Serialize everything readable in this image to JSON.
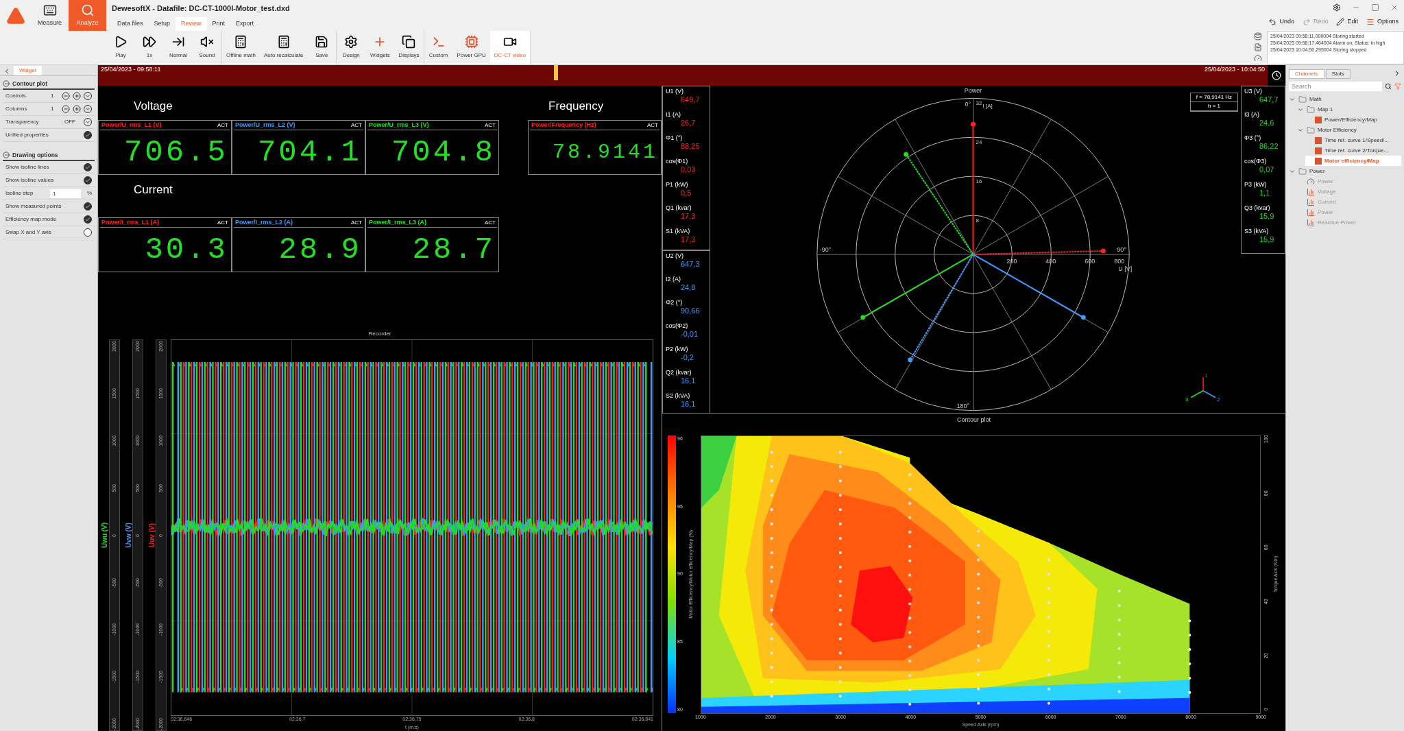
{
  "ribbon": {
    "title": "DewesoftX - Datafile: DC-CT-1000I-Motor_test.dxd",
    "modes": [
      {
        "kind": "measure",
        "label": "Measure",
        "selected": false
      },
      {
        "kind": "analyze",
        "label": "Analyze",
        "selected": true
      }
    ],
    "menu": [
      {
        "label": "Data files",
        "selected": false
      },
      {
        "label": "Setup",
        "selected": false
      },
      {
        "label": "Review",
        "selected": true
      },
      {
        "label": "Print",
        "selected": false
      },
      {
        "label": "Export",
        "selected": false
      }
    ],
    "tool_groups": [
      [
        {
          "kind": "play",
          "label": "Play",
          "selected": false
        },
        {
          "kind": "speed",
          "label": "1x",
          "selected": false
        },
        {
          "kind": "normal",
          "label": "Normal",
          "selected": false
        },
        {
          "kind": "sound",
          "label": "Sound",
          "selected": false
        }
      ],
      [
        {
          "kind": "math",
          "label": "Offline math",
          "selected": false
        },
        {
          "kind": "recalc",
          "label": "Auto recalculate",
          "selected": false
        },
        {
          "kind": "save",
          "label": "Save",
          "selected": false
        }
      ],
      [
        {
          "kind": "design",
          "label": "Design",
          "selected": false
        },
        {
          "kind": "widgets",
          "label": "Widgets",
          "selected": false
        },
        {
          "kind": "displays",
          "label": "Displays",
          "selected": false
        }
      ],
      [
        {
          "kind": "custom",
          "label": "Custom",
          "selected": false
        },
        {
          "kind": "gpu",
          "label": "Power GPU",
          "selected": false
        },
        {
          "kind": "video",
          "label": "DC-CT video",
          "selected": true
        }
      ]
    ],
    "actions": [
      {
        "kind": "undo",
        "label": "Undo",
        "disabled": false
      },
      {
        "kind": "redo",
        "label": "Redo",
        "disabled": true
      },
      {
        "kind": "edit",
        "label": "Edit",
        "disabled": false
      },
      {
        "kind": "options",
        "label": "Options",
        "disabled": false
      }
    ],
    "log": [
      "25/04/2023 09:58:11,000004 Storing started",
      "25/04/2023 09:58:17,464004 Alarm on; Status: in high",
      "25/04/2023 10:04:50,295004 Storing stopped"
    ]
  },
  "timeline": {
    "start": "25/04/2023 - 09:58:11",
    "end": "25/04/2023 - 10:04:50",
    "level": 0.39
  },
  "sidebar": {
    "tab": "Widget",
    "sections": [
      {
        "title": "Contour plot",
        "rows": [
          {
            "kind": "stepper",
            "label": "Controls",
            "value": "1"
          },
          {
            "kind": "stepper",
            "label": "Columns",
            "value": "1"
          },
          {
            "kind": "dropdown",
            "label": "Transparency",
            "value": "OFF"
          },
          {
            "kind": "check",
            "label": "Unified properties",
            "checked": true
          }
        ]
      },
      {
        "title": "Drawing options",
        "rows": [
          {
            "kind": "check",
            "label": "Show isoline lines",
            "checked": true
          },
          {
            "kind": "check",
            "label": "Show isoline values",
            "checked": true
          },
          {
            "kind": "input",
            "label": "Isoline step",
            "value": "1",
            "unit": "%"
          },
          {
            "kind": "check",
            "label": "Show measured points",
            "checked": true
          },
          {
            "kind": "check",
            "label": "Efficiency map mode",
            "checked": true
          },
          {
            "kind": "check",
            "label": "Swap X and Y axis",
            "checked": false
          }
        ]
      }
    ]
  },
  "meters": [
    {
      "title": "Voltage",
      "items": [
        {
          "channel": "Power/U_rms_L1 (V)",
          "color": "#ff2020",
          "status": "ACT",
          "value": "706.5"
        },
        {
          "channel": "Power/U_rms_L2 (V)",
          "color": "#3b9bff",
          "status": "ACT",
          "value": "704.1"
        },
        {
          "channel": "Power/U_rms_L3 (V)",
          "color": "#22dd22",
          "status": "ACT",
          "value": "704.8"
        }
      ]
    },
    {
      "title": "Current",
      "items": [
        {
          "channel": "Power/I_rms_L1 (A)",
          "color": "#ff2020",
          "status": "ACT",
          "value": "30.3"
        },
        {
          "channel": "Power/I_rms_L2 (A)",
          "color": "#3b9bff",
          "status": "ACT",
          "value": "28.9"
        },
        {
          "channel": "Power/I_rms_L3 (A)",
          "color": "#22dd22",
          "status": "ACT",
          "value": "28.7"
        }
      ]
    },
    {
      "title": "Frequency",
      "items": [
        {
          "channel": "Power/Frequency (Hz)",
          "color": "#ff2020",
          "status": "ACT",
          "value": "78.9141"
        }
      ]
    }
  ],
  "phasor": {
    "title": "Power",
    "info": [
      "f = 78,9141 Hz",
      "h = 1"
    ],
    "phases": [
      {
        "color": "#ff2020",
        "rows": [
          {
            "label": "U1 (V)",
            "value": "649,7"
          },
          {
            "label": "I1 (A)",
            "value": "26,7"
          },
          {
            "label": "Φ1 (°)",
            "value": "88,25"
          },
          {
            "label": "cos(Φ1)",
            "value": "0,03"
          },
          {
            "label": "P1 (kW)",
            "value": "0,5"
          },
          {
            "label": "Q1 (kvar)",
            "value": "17,3"
          },
          {
            "label": "S1 (kVA)",
            "value": "17,3"
          }
        ]
      },
      {
        "color": "#3b9bff",
        "rows": [
          {
            "label": "U2 (V)",
            "value": "647,3"
          },
          {
            "label": "I2 (A)",
            "value": "24,8"
          },
          {
            "label": "Φ2 (°)",
            "value": "90,66"
          },
          {
            "label": "cos(Φ2)",
            "value": "-0,01"
          },
          {
            "label": "P2 (kW)",
            "value": "-0,2"
          },
          {
            "label": "Q2 (kvar)",
            "value": "16,1"
          },
          {
            "label": "S2 (kVA)",
            "value": "16,1"
          }
        ]
      },
      {
        "color": "#22dd22",
        "rows": [
          {
            "label": "U3 (V)",
            "value": "647,7"
          },
          {
            "label": "I3 (A)",
            "value": "24,6"
          },
          {
            "label": "Φ3 (°)",
            "value": "86,22"
          },
          {
            "label": "cos(Φ3)",
            "value": "0,07"
          },
          {
            "label": "P3 (kW)",
            "value": "1,1"
          },
          {
            "label": "Q3 (kvar)",
            "value": "15,9"
          },
          {
            "label": "S3 (kVA)",
            "value": "15,9"
          }
        ]
      }
    ],
    "angle_labels": [
      "0°",
      "90°",
      "180°",
      "-90°"
    ],
    "u_ticks": [
      "200",
      "400",
      "600",
      "800"
    ],
    "u_label": "U [V]",
    "i_ticks": [
      "32",
      "24",
      "16",
      "8"
    ],
    "i_label": "I [A]",
    "triad_labels": [
      "1",
      "2",
      "3"
    ]
  },
  "recorder": {
    "title": "Recorder",
    "y_axes": [
      {
        "label": "Uwu (V)",
        "color": "#22dd22",
        "ticks": [
          "2000",
          "1500",
          "1000",
          "500",
          "0",
          "-500",
          "-1000",
          "-1500",
          "-2000"
        ]
      },
      {
        "label": "Uvw (V)",
        "color": "#3b9bff",
        "ticks": [
          "2000",
          "1500",
          "1000",
          "500",
          "0",
          "-500",
          "-1000",
          "-1500",
          "-2000"
        ]
      },
      {
        "label": "Uuv (V)",
        "color": "#ff2020",
        "ticks": [
          "2000",
          "1500",
          "1000",
          "500",
          "0",
          "-500",
          "-1000",
          "-1500",
          "-2000"
        ]
      }
    ],
    "x_ticks": [
      "02:36,646",
      "02:36,7",
      "02:36,75",
      "02:36,8",
      "02:36,841"
    ],
    "x_label": "t (m:s)"
  },
  "contour": {
    "title": "Contour plot",
    "scale_ticks": [
      "96",
      "95",
      "90",
      "85",
      "80"
    ],
    "scale_label": "Motor Efficiency/Motor efficiency/Map (%)",
    "x_ticks": [
      "1000",
      "2000",
      "3000",
      "4000",
      "5000",
      "6000",
      "7000",
      "8000",
      "9000"
    ],
    "x_label": "Speed Axis (rpm)",
    "y_ticks": [
      "100",
      "80",
      "60",
      "40",
      "20",
      "0"
    ],
    "y_label": "Torque Axis (Nm)"
  },
  "channels": {
    "tabs": [
      {
        "label": "Channels",
        "selected": true
      },
      {
        "label": "Slots",
        "selected": false
      }
    ],
    "search": {
      "placeholder": "Search"
    },
    "tree": [
      {
        "kind": "group",
        "label": "Math",
        "selected": false,
        "disabled": false,
        "children": [
          {
            "kind": "group",
            "label": "Map 1",
            "selected": false,
            "disabled": false,
            "children": [
              {
                "kind": "channel",
                "label": "Power/Efficiency/Map",
                "selected": false,
                "disabled": false
              }
            ]
          },
          {
            "kind": "group",
            "label": "Motor Efficiency",
            "selected": false,
            "disabled": false,
            "children": [
              {
                "kind": "channel",
                "label": "Time ref. curve 1/Speed/...",
                "selected": false,
                "disabled": false
              },
              {
                "kind": "channel",
                "label": "Time ref. curve 2/Torque...",
                "selected": false,
                "disabled": false
              },
              {
                "kind": "channel",
                "label": "Motor efficiency/Map",
                "selected": true,
                "disabled": false
              }
            ]
          }
        ]
      },
      {
        "kind": "group",
        "label": "Power",
        "selected": false,
        "disabled": false,
        "children": [
          {
            "kind": "module",
            "label": "Power",
            "selected": false,
            "disabled": true
          },
          {
            "kind": "chart",
            "label": "Voltage",
            "selected": false,
            "disabled": true
          },
          {
            "kind": "chart",
            "label": "Current",
            "selected": false,
            "disabled": true
          },
          {
            "kind": "chart",
            "label": "Power",
            "selected": false,
            "disabled": true
          },
          {
            "kind": "chart",
            "label": "Reactive Power",
            "selected": false,
            "disabled": true
          }
        ]
      }
    ]
  }
}
